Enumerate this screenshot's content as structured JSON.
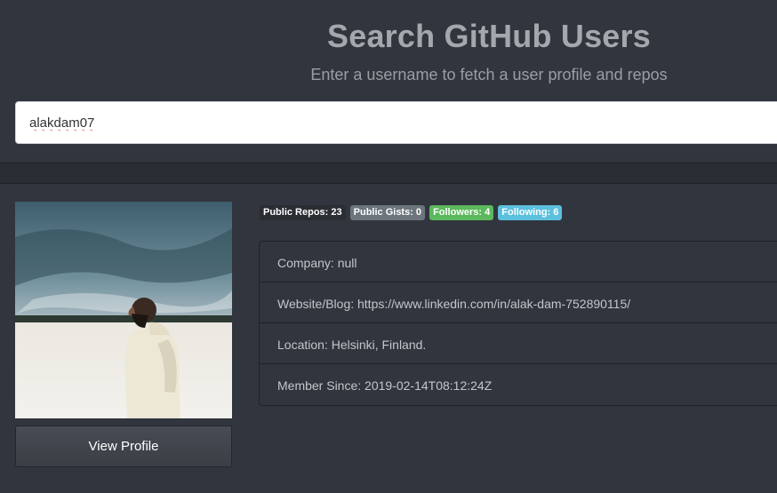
{
  "header": {
    "title": "Search GitHub Users",
    "subtitle": "Enter a username to fetch a user profile and repos"
  },
  "search": {
    "value": "alakdam07",
    "placeholder": ""
  },
  "profile": {
    "view_profile_label": "View Profile",
    "avatar_icon": "user-photo"
  },
  "badges": {
    "public_repos": "Public Repos: 23",
    "public_gists": "Public Gists: 0",
    "followers": "Followers: 4",
    "following": "Following: 6"
  },
  "details": {
    "company": "Company: null",
    "website": "Website/Blog: https://www.linkedin.com/in/alak-dam-752890115/",
    "location": "Location: Helsinki, Finland.",
    "member_since": "Member Since: 2019-02-14T08:12:24Z"
  },
  "colors": {
    "background": "#31353d",
    "badge_dark": "#2a2d32",
    "badge_gray": "#6c757d",
    "badge_green": "#5cb85c",
    "badge_blue": "#5bc0de"
  }
}
